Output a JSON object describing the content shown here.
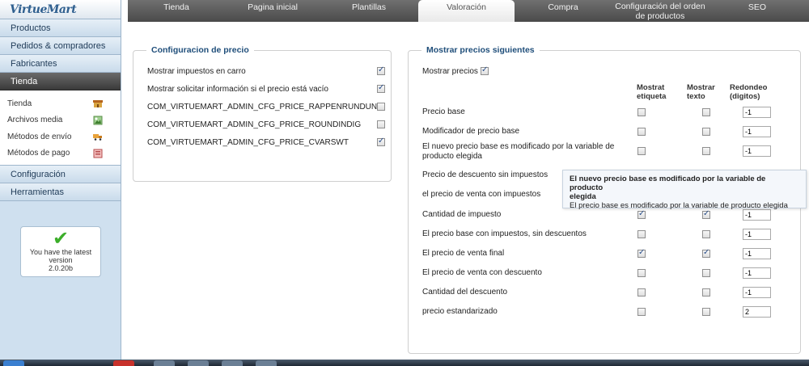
{
  "logo": {
    "text": "VirtueMart"
  },
  "sidebar": {
    "menus_top": [
      "Productos",
      "Pedidos & compradores",
      "Fabricantes"
    ],
    "active_menu": "Tienda",
    "submenu": [
      {
        "label": "Tienda",
        "icon": "store-icon"
      },
      {
        "label": "Archivos media",
        "icon": "media-files-icon"
      },
      {
        "label": "Métodos de envío",
        "icon": "shipping-truck-icon"
      },
      {
        "label": "Métodos de pago",
        "icon": "payment-icon"
      }
    ],
    "menus_bottom": [
      "Configuración",
      "Herramientas"
    ],
    "version_box": {
      "line1": "You have the latest",
      "line2": "version",
      "version": "2.0.20b"
    }
  },
  "tabs": {
    "t0": "Tienda",
    "t1": "Pagina inicial",
    "t2": "Plantillas",
    "t3": "Valoración",
    "t4": "Compra",
    "t5a": "Configuración del orden",
    "t5b": "de productos",
    "t6": "SEO",
    "active": "Valoración"
  },
  "price_config": {
    "legend": "Configuracion de precio",
    "rows": [
      {
        "label": "Mostrar impuestos en carro",
        "checked": true
      },
      {
        "label": "Mostrar solicitar información si el precio está vacío",
        "checked": true
      },
      {
        "label": "COM_VIRTUEMART_ADMIN_CFG_PRICE_RAPPENRUNDUNG",
        "checked": false
      },
      {
        "label": "COM_VIRTUEMART_ADMIN_CFG_PRICE_ROUNDINDIG",
        "checked": false
      },
      {
        "label": "COM_VIRTUEMART_ADMIN_CFG_PRICE_CVARSWT",
        "checked": true
      }
    ]
  },
  "show_prices": {
    "legend": "Mostrar precios siguientes",
    "master_label": "Mostrar precios",
    "master_checked": true,
    "headers": {
      "label_a": "Mostrat",
      "label_b": "etiqueta",
      "text_a": "Mostrar",
      "text_b": "texto",
      "round_a": "Redondeo",
      "round_b": "(digitos)"
    },
    "rows": [
      {
        "l1": "Precio base",
        "l2": "",
        "show_label": false,
        "show_text": false,
        "rounding": "-1"
      },
      {
        "l1": "Modificador de precio base",
        "l2": "",
        "show_label": false,
        "show_text": false,
        "rounding": "-1"
      },
      {
        "l1": "El nuevo precio base es modificado por la variable de",
        "l2": "producto elegida",
        "show_label": false,
        "show_text": false,
        "rounding": "-1"
      },
      {
        "l1": "Precio de descuento sin impuestos",
        "l2": "",
        "hidden": true
      },
      {
        "l1": "el precio de venta con impuestos",
        "l2": "",
        "hidden": true
      },
      {
        "l1": "Cantidad de impuesto",
        "l2": "",
        "show_label": true,
        "show_text": true,
        "rounding": "-1"
      },
      {
        "l1": "El precio base con impuestos, sin descuentos",
        "l2": "",
        "show_label": false,
        "show_text": false,
        "rounding": "-1"
      },
      {
        "l1": "El precio de venta final",
        "l2": "",
        "show_label": true,
        "show_text": true,
        "rounding": "-1"
      },
      {
        "l1": "El precio de venta con descuento",
        "l2": "",
        "show_label": false,
        "show_text": false,
        "rounding": "-1"
      },
      {
        "l1": "Cantidad del descuento",
        "l2": "",
        "show_label": false,
        "show_text": false,
        "rounding": "-1"
      },
      {
        "l1": "precio estandarizado",
        "l2": "",
        "show_label": false,
        "show_text": false,
        "rounding": "2"
      }
    ]
  },
  "tooltip": {
    "title_a": "El nuevo precio base es modificado por la variable de producto",
    "title_b": "elegida",
    "body": "El precio base es modificado por la variable de producto elegida"
  },
  "colors": {
    "tab_bar": "#5a5a5a",
    "sidebar_bg": "#cfe0ef",
    "legend_text": "#1f4e7a",
    "active_menu": "#4a4a4a",
    "check_green": "#3cae2a"
  }
}
